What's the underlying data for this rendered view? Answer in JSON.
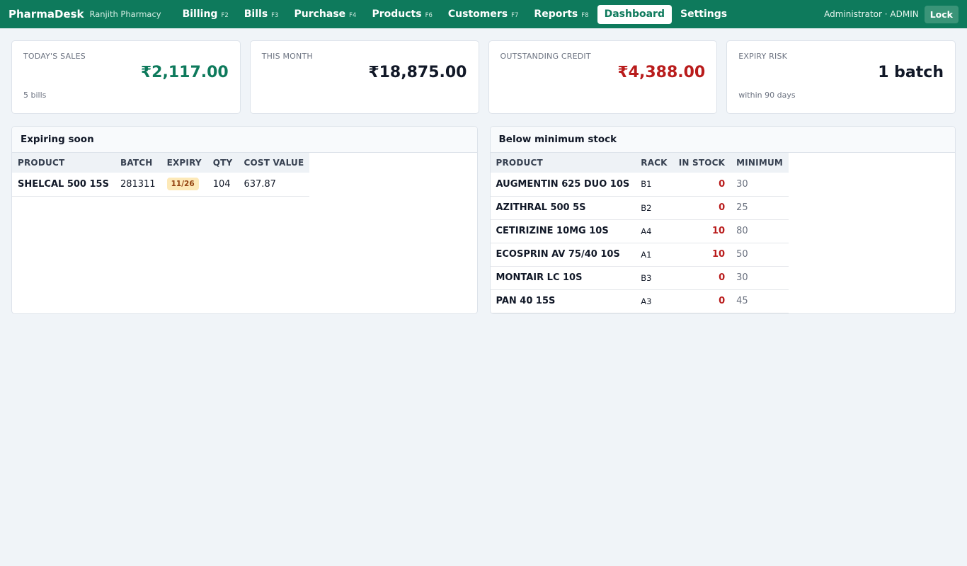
{
  "app": {
    "brand": "PharmaDesk",
    "pharmacy": "Ranjith Pharmacy",
    "user": "Administrator · ADMIN",
    "lock_label": "Lock"
  },
  "nav": [
    {
      "label": "Billing",
      "key": "F2"
    },
    {
      "label": "Bills",
      "key": "F3"
    },
    {
      "label": "Purchase",
      "key": "F4"
    },
    {
      "label": "Products",
      "key": "F6"
    },
    {
      "label": "Customers",
      "key": "F7"
    },
    {
      "label": "Reports",
      "key": "F8"
    },
    {
      "label": "Dashboard",
      "key": ""
    },
    {
      "label": "Settings",
      "key": ""
    }
  ],
  "active_nav": "Dashboard",
  "cards": {
    "today": {
      "label": "TODAY'S SALES",
      "value": "₹2,117.00",
      "sub": "5 bills"
    },
    "month": {
      "label": "THIS MONTH",
      "value": "₹18,875.00",
      "sub": ""
    },
    "credit": {
      "label": "OUTSTANDING CREDIT",
      "value": "₹4,388.00",
      "sub": ""
    },
    "expiry": {
      "label": "EXPIRY RISK",
      "value": "1 batch",
      "sub": "within 90 days"
    }
  },
  "expiring": {
    "title": "Expiring soon",
    "headers": {
      "product": "PRODUCT",
      "batch": "BATCH",
      "expiry": "EXPIRY",
      "qty": "QTY",
      "cost": "COST VALUE"
    },
    "rows": [
      {
        "product": "SHELCAL 500 15S",
        "batch": "281311",
        "expiry": "11/26",
        "qty": "104",
        "cost": "637.87"
      }
    ]
  },
  "low_stock": {
    "title": "Below minimum stock",
    "headers": {
      "product": "PRODUCT",
      "rack": "RACK",
      "stock": "IN STOCK",
      "min": "MINIMUM"
    },
    "rows": [
      {
        "product": "AUGMENTIN 625 DUO 10S",
        "rack": "B1",
        "stock": "0",
        "min": "30"
      },
      {
        "product": "AZITHRAL 500 5S",
        "rack": "B2",
        "stock": "0",
        "min": "25"
      },
      {
        "product": "CETIRIZINE 10MG 10S",
        "rack": "A4",
        "stock": "10",
        "min": "80"
      },
      {
        "product": "ECOSPRIN AV 75/40 10S",
        "rack": "A1",
        "stock": "10",
        "min": "50"
      },
      {
        "product": "MONTAIR LC 10S",
        "rack": "B3",
        "stock": "0",
        "min": "30"
      },
      {
        "product": "PAN 40 15S",
        "rack": "A3",
        "stock": "0",
        "min": "45"
      }
    ]
  },
  "colors": {
    "brand": "#0e7a5c",
    "positive": "#0e7a5c",
    "negative": "#b91c1c",
    "expiry_badge": "#fde9b8"
  }
}
